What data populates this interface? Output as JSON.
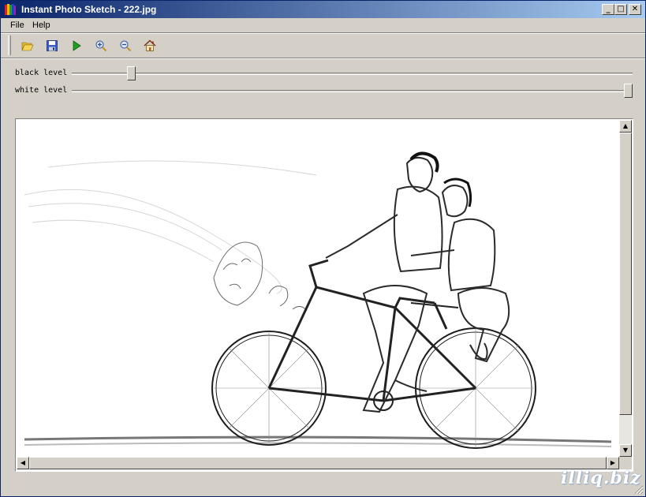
{
  "window": {
    "title": "Instant Photo Sketch - 222.jpg"
  },
  "titlebar_buttons": {
    "minimize": "_",
    "maximize": "□",
    "close": "✕"
  },
  "menu": [
    {
      "label": "File"
    },
    {
      "label": "Help"
    }
  ],
  "toolbar": [
    {
      "icon": "open-folder-icon"
    },
    {
      "icon": "save-icon"
    },
    {
      "icon": "play-icon"
    },
    {
      "icon": "zoom-in-icon"
    },
    {
      "icon": "zoom-out-icon"
    },
    {
      "icon": "home-icon"
    }
  ],
  "sliders": {
    "black_level": {
      "label": "black level",
      "value": 0.1
    },
    "white_level": {
      "label": "white level",
      "value": 1.0
    }
  },
  "scrollbars": {
    "vertical_position": 0.0,
    "horizontal_position": 0.0
  },
  "watermark": "illiq.biz",
  "colors": {
    "title_start": "#0a246a",
    "title_end": "#a6caf0",
    "face": "#d4d0c8"
  }
}
